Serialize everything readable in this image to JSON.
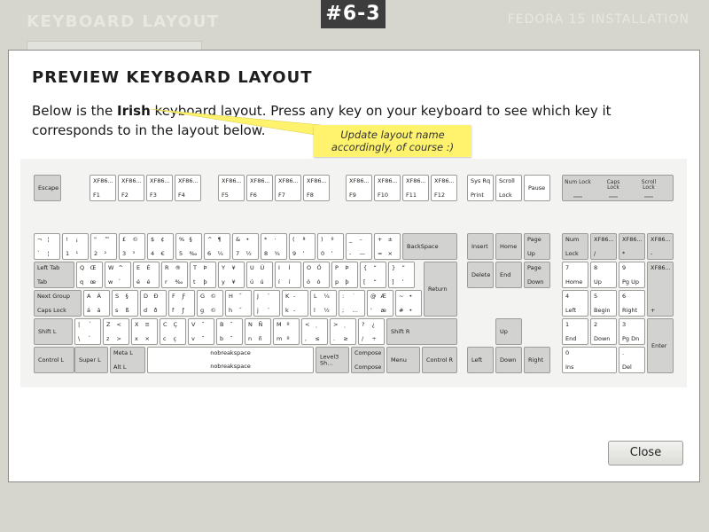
{
  "background": {
    "title": "KEYBOARD LAYOUT",
    "right_title": "FEDORA 15 INSTALLATION"
  },
  "badge": "#6-3",
  "dialog": {
    "title": "PREVIEW KEYBOARD LAYOUT",
    "desc_before": "Below is the ",
    "layout_name": "Irish",
    "desc_after": " keyboard layout. Press any key on your keyboard to see which key it corresponds to in the layout below.",
    "note": "Update layout name accordingly, of course :)",
    "close_label": "Close"
  },
  "colors": {
    "note": "#fff36e",
    "modifier_key": "#d2d2d0",
    "badge": "#3d3d3d"
  },
  "keys": [
    {
      "c": [
        "Escape"
      ],
      "m": 1
    },
    {
      "c": [
        "XF86...",
        "F1"
      ]
    },
    {
      "c": [
        "XF86...",
        "F2"
      ]
    },
    {
      "c": [
        "XF86...",
        "F3"
      ]
    },
    {
      "c": [
        "XF86...",
        "F4"
      ]
    },
    {
      "c": [
        "XF86...",
        "F5"
      ]
    },
    {
      "c": [
        "XF86...",
        "F6"
      ]
    },
    {
      "c": [
        "XF86...",
        "F7"
      ]
    },
    {
      "c": [
        "XF86...",
        "F8"
      ]
    },
    {
      "c": [
        "XF86...",
        "F9"
      ]
    },
    {
      "c": [
        "XF86...",
        "F10"
      ]
    },
    {
      "c": [
        "XF86...",
        "F11"
      ]
    },
    {
      "c": [
        "XF86...",
        "F12"
      ]
    },
    {
      "c": [
        "Sys Rq",
        "Print"
      ]
    },
    {
      "c": [
        "Scroll",
        "Lock"
      ]
    },
    {
      "c": [
        "Pause"
      ]
    },
    {
      "c": [
        "¬",
        "`",
        "¦",
        "¦"
      ]
    },
    {
      "c": [
        "!",
        "1",
        "¡",
        "¹"
      ]
    },
    {
      "c": [
        "\"",
        "2",
        "™",
        "²"
      ]
    },
    {
      "c": [
        "£",
        "3",
        "©",
        "³"
      ]
    },
    {
      "c": [
        "$",
        "4",
        "¢",
        "€"
      ]
    },
    {
      "c": [
        "%",
        "5",
        "§",
        "‰"
      ]
    },
    {
      "c": [
        "^",
        "6",
        "¶",
        "¼"
      ]
    },
    {
      "c": [
        "&",
        "7",
        "•",
        "½"
      ]
    },
    {
      "c": [
        "*",
        "8",
        "·",
        "¾"
      ]
    },
    {
      "c": [
        "(",
        "9",
        "ª",
        "‘"
      ]
    },
    {
      "c": [
        ")",
        "0",
        "º",
        "’"
      ]
    },
    {
      "c": [
        "_",
        "-",
        "–",
        "—"
      ]
    },
    {
      "c": [
        "+",
        "=",
        "±",
        "×"
      ]
    },
    {
      "c": [
        "BackSpace"
      ],
      "m": 1
    },
    {
      "c": [
        "Left Tab",
        "Tab"
      ],
      "m": 1
    },
    {
      "c": [
        "Q",
        "q",
        "Œ",
        "œ"
      ]
    },
    {
      "c": [
        "W",
        "w",
        "^",
        "`"
      ]
    },
    {
      "c": [
        "E",
        "é",
        "É",
        "é"
      ]
    },
    {
      "c": [
        "R",
        "r",
        "®",
        "‰"
      ]
    },
    {
      "c": [
        "T",
        "t",
        "Þ",
        "þ"
      ]
    },
    {
      "c": [
        "Y",
        "y",
        "¥",
        "¥"
      ]
    },
    {
      "c": [
        "U",
        "ú",
        "Ú",
        "ú"
      ]
    },
    {
      "c": [
        "I",
        "í",
        "Í",
        "í"
      ]
    },
    {
      "c": [
        "O",
        "ó",
        "Ó",
        "ó"
      ]
    },
    {
      "c": [
        "P",
        "p",
        "Þ",
        "þ"
      ]
    },
    {
      "c": [
        "{",
        "[",
        "“",
        "“"
      ]
    },
    {
      "c": [
        "}",
        "]",
        "”",
        "’"
      ]
    },
    {
      "c": [
        "Return"
      ],
      "m": 1
    },
    {
      "c": [
        "Next Group",
        "Caps Lock"
      ],
      "m": 1
    },
    {
      "c": [
        "A",
        "á",
        "Á",
        "á"
      ]
    },
    {
      "c": [
        "S",
        "s",
        "§",
        "ß"
      ]
    },
    {
      "c": [
        "D",
        "d",
        "Ð",
        "ð"
      ]
    },
    {
      "c": [
        "F",
        "f",
        "Ƒ",
        "ƒ"
      ]
    },
    {
      "c": [
        "G",
        "g",
        "©",
        "©"
      ]
    },
    {
      "c": [
        "H",
        "h",
        "˝",
        "˝"
      ]
    },
    {
      "c": [
        "J",
        "j",
        "¨",
        "¨"
      ]
    },
    {
      "c": [
        "K",
        "k",
        "̵",
        "̵"
      ]
    },
    {
      "c": [
        "L",
        "l",
        "¼",
        "½"
      ]
    },
    {
      "c": [
        ":",
        ";",
        "˙",
        "…"
      ]
    },
    {
      "c": [
        "@",
        "'",
        "Æ",
        "æ"
      ]
    },
    {
      "c": [
        "~",
        "#",
        "•",
        "•"
      ]
    },
    {
      "c": [
        "Shift L"
      ],
      "m": 1
    },
    {
      "c": [
        "|",
        "\\",
        "´",
        "`"
      ]
    },
    {
      "c": [
        "Z",
        "z",
        "<",
        ">"
      ]
    },
    {
      "c": [
        "X",
        "x",
        "≡",
        "×"
      ]
    },
    {
      "c": [
        "C",
        "c",
        "Ç",
        "ç"
      ]
    },
    {
      "c": [
        "V",
        "v",
        "˘",
        "˘"
      ]
    },
    {
      "c": [
        "B",
        "b",
        "˘",
        "˘"
      ]
    },
    {
      "c": [
        "N",
        "n",
        "Ñ",
        "ñ"
      ]
    },
    {
      "c": [
        "M",
        "m",
        "º",
        "º"
      ]
    },
    {
      "c": [
        "<",
        ",",
        "˛",
        "≤"
      ]
    },
    {
      "c": [
        ">",
        ".",
        "˛",
        "≥"
      ]
    },
    {
      "c": [
        "?",
        "/",
        "¿",
        "÷"
      ]
    },
    {
      "c": [
        "Shift R"
      ],
      "m": 1
    },
    {
      "c": [
        "Control L"
      ],
      "m": 1
    },
    {
      "c": [
        "Super L"
      ],
      "m": 1
    },
    {
      "c": [
        "Meta L",
        "Alt L"
      ],
      "m": 1
    },
    {
      "c": [
        "nobreakspace",
        "nobreakspace"
      ]
    },
    {
      "c": [
        "Level3 Sh..."
      ],
      "m": 1
    },
    {
      "c": [
        "Compose",
        "Compose"
      ],
      "m": 1
    },
    {
      "c": [
        "Menu"
      ],
      "m": 1
    },
    {
      "c": [
        "Control R"
      ],
      "m": 1
    },
    {
      "c": [
        "Insert"
      ],
      "m": 1
    },
    {
      "c": [
        "Home"
      ],
      "m": 1
    },
    {
      "c": [
        "Page",
        "Up"
      ],
      "m": 1
    },
    {
      "c": [
        "Delete"
      ],
      "m": 1
    },
    {
      "c": [
        "End"
      ],
      "m": 1
    },
    {
      "c": [
        "Page",
        "Down"
      ],
      "m": 1
    },
    {
      "c": [
        "Up"
      ],
      "m": 1
    },
    {
      "c": [
        "Left"
      ],
      "m": 1
    },
    {
      "c": [
        "Down"
      ],
      "m": 1
    },
    {
      "c": [
        "Right"
      ],
      "m": 1
    },
    {
      "c": [
        "Num",
        "Lock"
      ],
      "m": 1
    },
    {
      "c": [
        "XF86...",
        "/"
      ],
      "m": 1
    },
    {
      "c": [
        "XF86...",
        "*"
      ],
      "m": 1
    },
    {
      "c": [
        "XF86...",
        "-"
      ],
      "m": 1
    },
    {
      "c": [
        "7",
        "Home"
      ]
    },
    {
      "c": [
        "8",
        "Up"
      ]
    },
    {
      "c": [
        "9",
        "Pg Up"
      ]
    },
    {
      "c": [
        "XF86...",
        "+"
      ],
      "m": 1
    },
    {
      "c": [
        "4",
        "Left"
      ]
    },
    {
      "c": [
        "5",
        "Begin"
      ]
    },
    {
      "c": [
        "6",
        "Right"
      ]
    },
    {
      "c": [
        "1",
        "End"
      ]
    },
    {
      "c": [
        "2",
        "Down"
      ]
    },
    {
      "c": [
        "3",
        "Pg Dn"
      ]
    },
    {
      "c": [
        "Enter"
      ],
      "m": 1
    },
    {
      "c": [
        "0",
        "Ins"
      ]
    },
    {
      "c": [
        ".",
        "Del"
      ]
    }
  ],
  "leds": [
    "Num Lock",
    "Caps Lock",
    "Scroll Lock"
  ]
}
